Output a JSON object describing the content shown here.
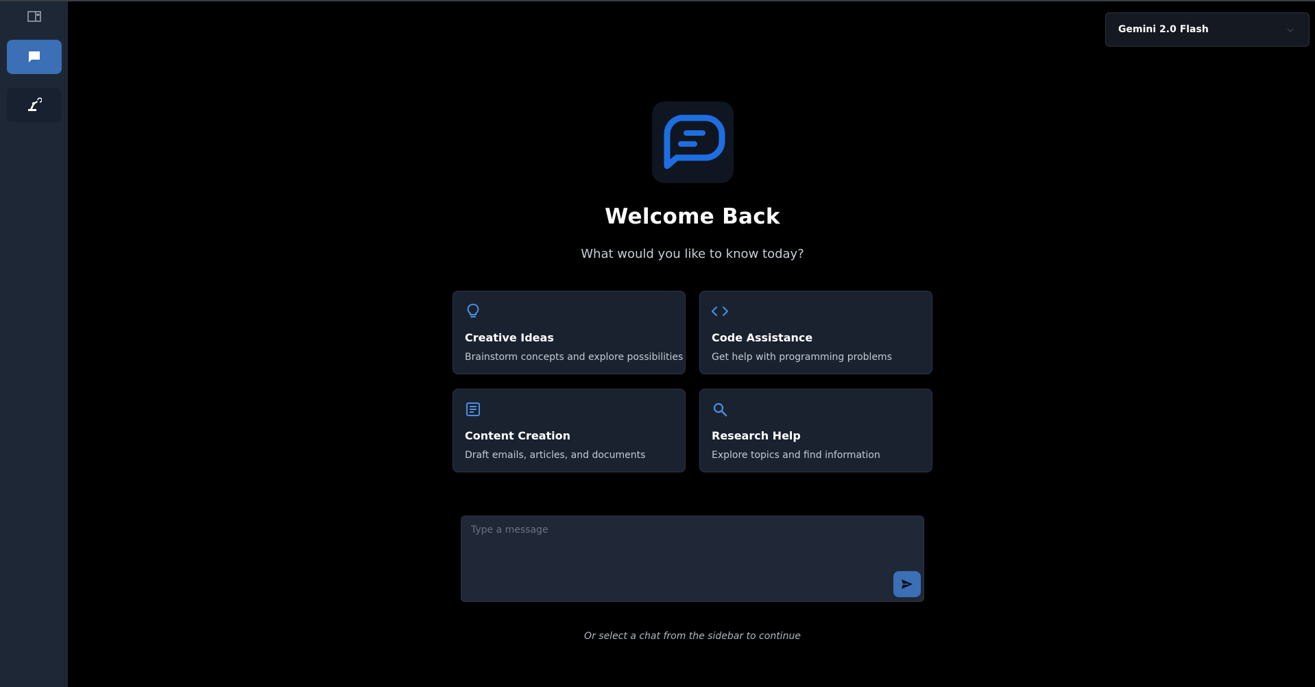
{
  "model_selector": {
    "selected": "Gemini 2.0 Flash"
  },
  "welcome": {
    "title": "Welcome Back",
    "subtitle": "What would you like to know today?"
  },
  "cards": [
    {
      "title": "Creative Ideas",
      "description": "Brainstorm concepts and explore possibilities",
      "icon": "lightbulb-icon"
    },
    {
      "title": "Code Assistance",
      "description": "Get help with programming problems",
      "icon": "code-icon"
    },
    {
      "title": "Content Creation",
      "description": "Draft emails, articles, and documents",
      "icon": "document-icon"
    },
    {
      "title": "Research Help",
      "description": "Explore topics and find information",
      "icon": "search-icon"
    }
  ],
  "composer": {
    "placeholder": "Type a message"
  },
  "footer_hint": "Or select a chat from the sidebar to continue",
  "colors": {
    "accent": "#3b6fb6",
    "icon_blue": "#4a90e2",
    "logo_blue": "#1e6ee0",
    "sidebar_bg": "#1e2735",
    "card_bg": "#1a2230"
  }
}
